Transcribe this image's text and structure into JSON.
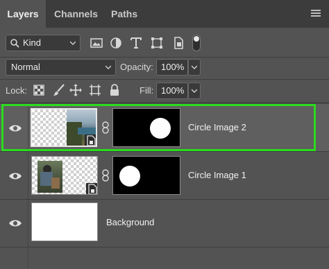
{
  "tabs": [
    {
      "label": "Layers",
      "active": true
    },
    {
      "label": "Channels",
      "active": false
    },
    {
      "label": "Paths",
      "active": false
    }
  ],
  "filter": {
    "kind_label": "Kind",
    "icons": [
      "image-filter-icon",
      "adjustment-filter-icon",
      "type-filter-icon",
      "shape-filter-icon",
      "smart-object-filter-icon",
      "filter-toggle-icon"
    ]
  },
  "blend": {
    "mode": "Normal",
    "opacity_label": "Opacity:",
    "opacity_value": "100%"
  },
  "lock": {
    "label": "Lock:",
    "icons": [
      "lock-transparent-icon",
      "lock-paint-icon",
      "lock-position-icon",
      "lock-artboard-icon",
      "lock-all-icon"
    ],
    "fill_label": "Fill:",
    "fill_value": "100%"
  },
  "layers": [
    {
      "name": "Circle Image 2",
      "selected": true,
      "visible": true,
      "has_mask": true
    },
    {
      "name": "Circle Image 1",
      "selected": false,
      "visible": true,
      "has_mask": true
    },
    {
      "name": "Background",
      "selected": false,
      "visible": true,
      "has_mask": false
    }
  ],
  "colors": {
    "panel_bg": "#535353",
    "tabbar_bg": "#3c3c3c",
    "highlight_border": "#2bdc1e",
    "selected_row": "#5f5f5f"
  }
}
